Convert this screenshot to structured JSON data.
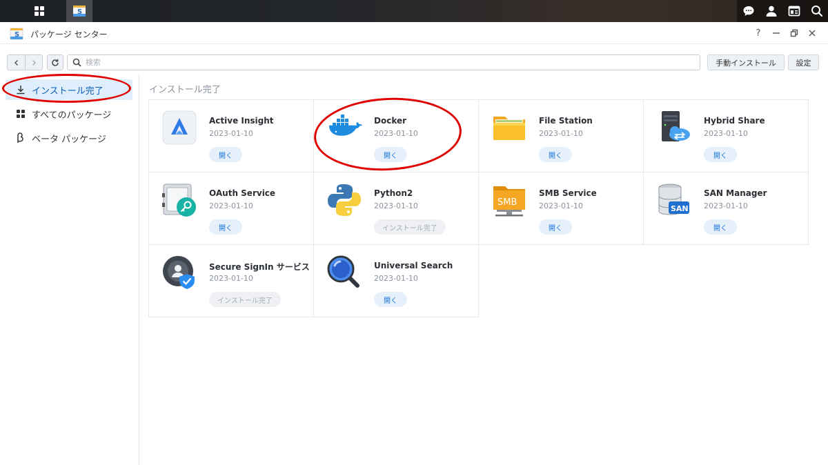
{
  "window": {
    "title": "パッケージ センター",
    "help": "?"
  },
  "toolbar": {
    "search_placeholder": "検索",
    "manual_install": "手動インストール",
    "settings": "設定"
  },
  "sidebar": {
    "items": [
      {
        "label": "インストール完了",
        "icon": "download-icon",
        "active": true
      },
      {
        "label": "すべてのパッケージ",
        "icon": "grid-icon",
        "active": false
      },
      {
        "label": "ベータ パッケージ",
        "icon": "beta-icon",
        "active": false
      }
    ]
  },
  "main": {
    "section_title": "インストール完了",
    "packages": [
      {
        "name": "Active Insight",
        "date": "2023-01-10",
        "action": "開く",
        "installed_only": false,
        "icon": "active-insight-icon"
      },
      {
        "name": "Docker",
        "date": "2023-01-10",
        "action": "開く",
        "installed_only": false,
        "icon": "docker-icon"
      },
      {
        "name": "File Station",
        "date": "2023-01-10",
        "action": "開く",
        "installed_only": false,
        "icon": "folder-icon"
      },
      {
        "name": "Hybrid Share",
        "date": "2023-01-10",
        "action": "開く",
        "installed_only": false,
        "icon": "hybrid-share-icon"
      },
      {
        "name": "OAuth Service",
        "date": "2023-01-10",
        "action": "開く",
        "installed_only": false,
        "icon": "oauth-safe-icon"
      },
      {
        "name": "Python2",
        "date": "2023-01-10",
        "action": "インストール完了",
        "installed_only": true,
        "icon": "python-icon"
      },
      {
        "name": "SMB Service",
        "date": "2023-01-10",
        "action": "開く",
        "installed_only": false,
        "icon": "smb-folder-icon"
      },
      {
        "name": "SAN Manager",
        "date": "2023-01-10",
        "action": "開く",
        "installed_only": false,
        "icon": "san-database-icon"
      },
      {
        "name": "Secure SignIn サービス",
        "date": "2023-01-10",
        "action": "インストール完了",
        "installed_only": true,
        "icon": "secure-signin-icon"
      },
      {
        "name": "Universal Search",
        "date": "2023-01-10",
        "action": "開く",
        "installed_only": false,
        "icon": "magnifier-icon"
      }
    ]
  },
  "icon_labels": {
    "smb": "SMB",
    "san": "SAN"
  },
  "colors": {
    "accent": "#1a73d9",
    "annotation": "#e00000",
    "sidebar_active_bg": "#dfeefc"
  }
}
